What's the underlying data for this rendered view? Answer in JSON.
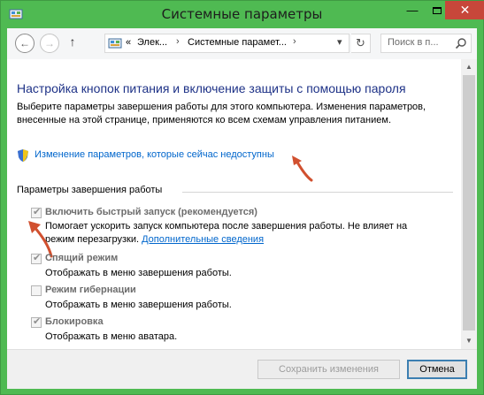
{
  "window": {
    "title": "Системные параметры",
    "minimize": "—",
    "close": "✕"
  },
  "nav": {
    "back": "←",
    "forward": "→",
    "up": "↑",
    "breadcrumb_prefix": "«",
    "breadcrumb_1": "Элек...",
    "breadcrumb_2": "Системные парамет...",
    "separator": "›",
    "refresh": "↻",
    "search_placeholder": "Поиск в п..."
  },
  "page": {
    "title": "Настройка кнопок питания и включение защиты с помощью пароля",
    "description": "Выберите параметры завершения работы для этого компьютера. Изменения параметров, внесенные на этой странице, применяются ко всем схемам управления питанием.",
    "change_link": "Изменение параметров, которые сейчас недоступны"
  },
  "shutdown": {
    "group_title": "Параметры завершения работы",
    "options": [
      {
        "label": "Включить быстрый запуск (рекомендуется)",
        "checked": true,
        "desc_line1": "Помогает ускорить запуск компьютера после завершения работы. Не влияет на",
        "desc_line2": "режим перезагрузки.",
        "desc_link": "Дополнительные сведения"
      },
      {
        "label": "Спящий режим",
        "checked": true,
        "desc_line1": "Отображать в меню завершения работы."
      },
      {
        "label": "Режим гибернации",
        "checked": false,
        "desc_line1": "Отображать в меню завершения работы."
      },
      {
        "label": "Блокировка",
        "checked": true,
        "desc_line1": "Отображать в меню аватара."
      }
    ]
  },
  "footer": {
    "save_label": "Сохранить изменения",
    "cancel_label": "Отмена"
  },
  "colors": {
    "title_bar": "#4fba52",
    "close_button": "#c7473a",
    "link": "#0066cc",
    "heading": "#1e3287",
    "annotation_arrow": "#d1502f"
  }
}
